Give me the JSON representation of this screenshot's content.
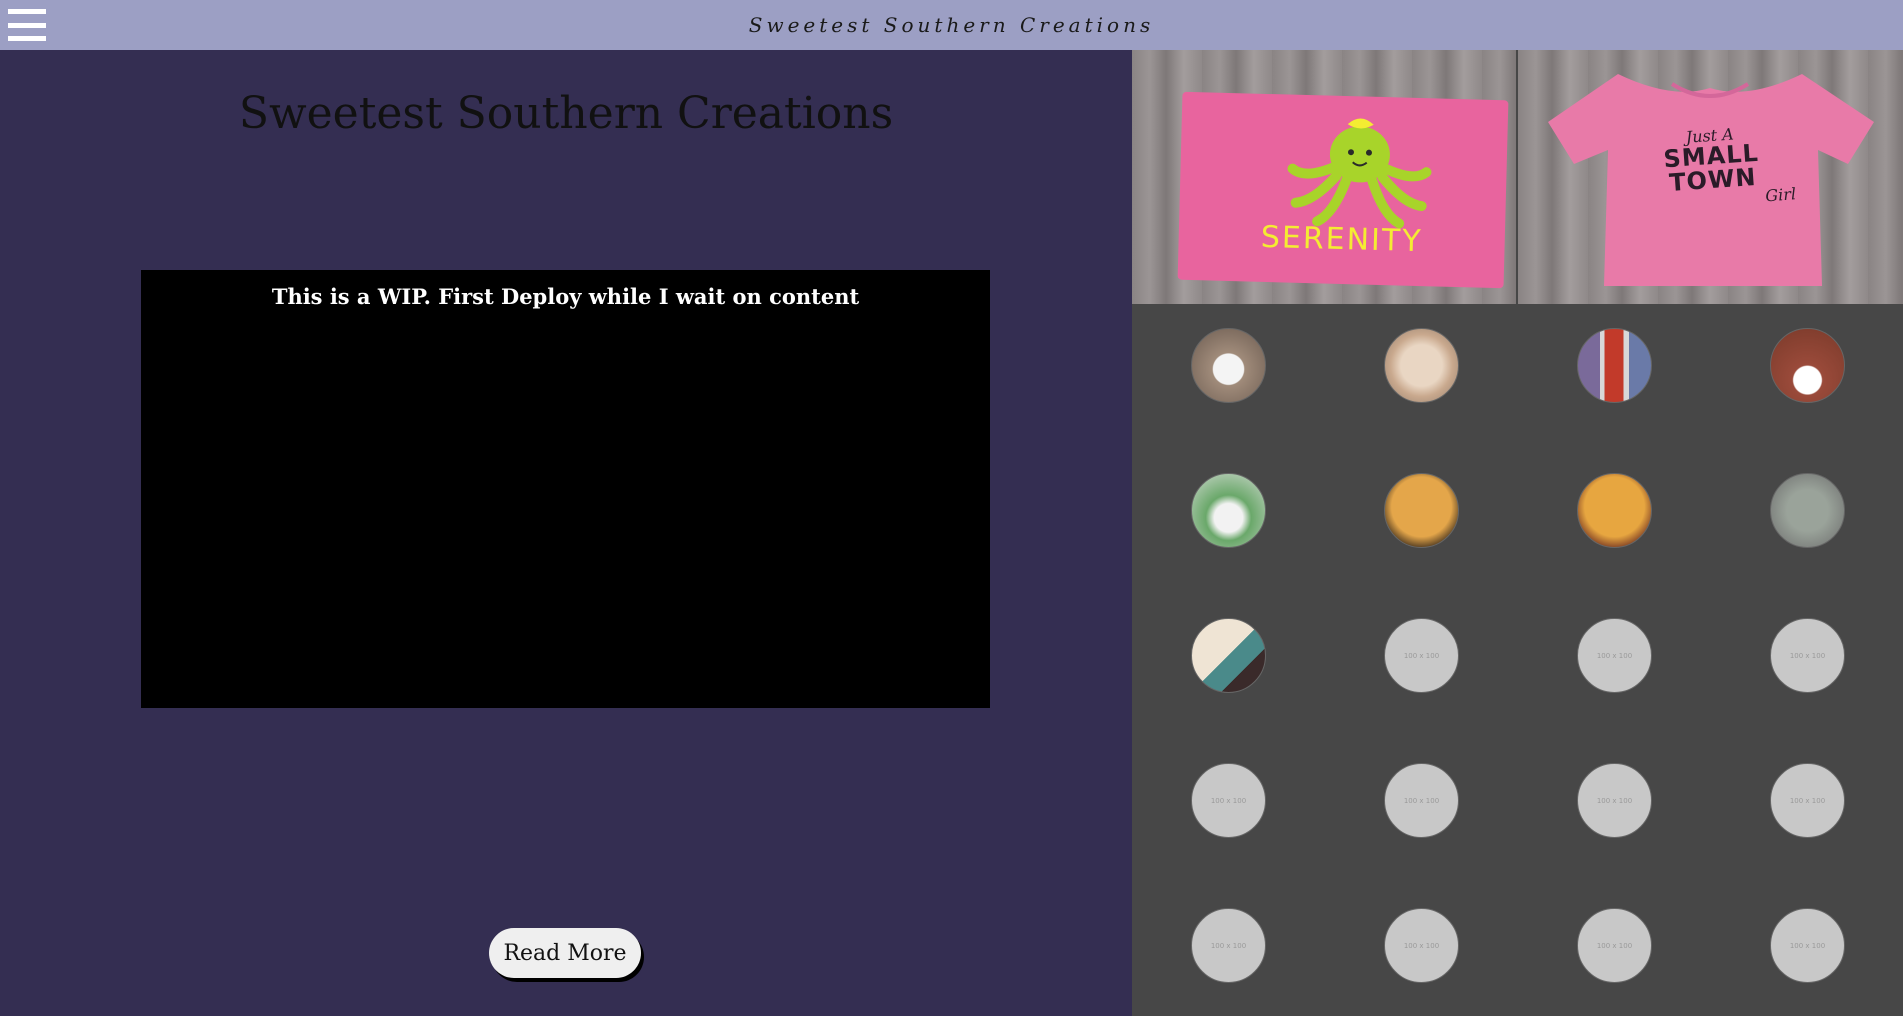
{
  "header": {
    "brand": "Sweetest Southern Creations",
    "menu_icon": "hamburger-menu-icon"
  },
  "main": {
    "title": "Sweetest Southern Creations",
    "video_caption": "This is a WIP. First Deploy while I wait on content",
    "read_more_label": "Read More"
  },
  "gallery": {
    "hero_images": [
      {
        "name": "pink-towel-serenity",
        "text": "SERENITY"
      },
      {
        "name": "pink-shirt-small-town-girl",
        "line1": "Just A",
        "line2": "SMALL",
        "line3": "TOWN",
        "line4": "Girl"
      }
    ],
    "placeholder_label": "100 x 100",
    "thumbnails": [
      "snoopy-mug",
      "name-sign",
      "tumblers",
      "girl-shirt",
      "kid-shirt",
      "kiss-emoji-pillow",
      "wink-emoji-pillow",
      "grey-shirt",
      "big-sister-shirts",
      "placeholder",
      "placeholder",
      "placeholder",
      "placeholder",
      "placeholder",
      "placeholder",
      "placeholder",
      "placeholder",
      "placeholder",
      "placeholder",
      "placeholder"
    ]
  },
  "colors": {
    "topbar": "#9c9fc4",
    "left_panel": "#342e52",
    "right_panel": "#474747",
    "video_bg": "#000000",
    "button_bg": "#efefef"
  }
}
